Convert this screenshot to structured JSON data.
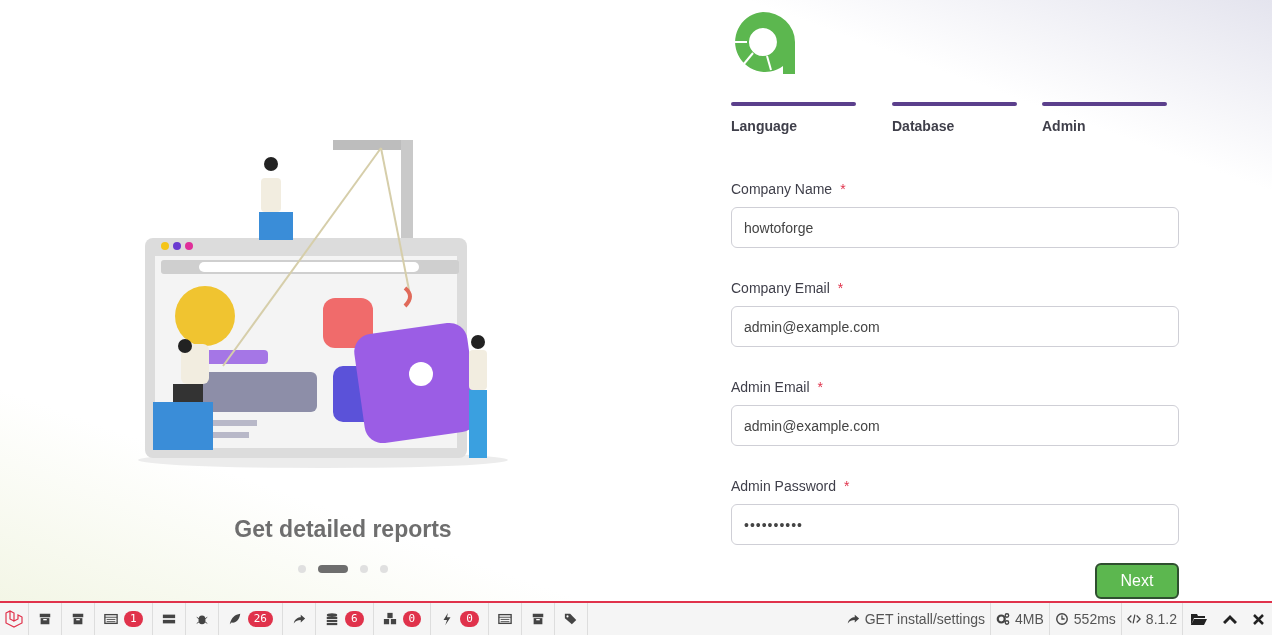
{
  "slideshow": {
    "caption": "Get detailed reports",
    "dots": [
      {
        "selected": false
      },
      {
        "selected": true
      },
      {
        "selected": false
      },
      {
        "selected": false
      }
    ]
  },
  "steps": [
    {
      "label": "Language",
      "completed": true
    },
    {
      "label": "Database",
      "completed": true
    },
    {
      "label": "Admin",
      "completed": true
    }
  ],
  "form": {
    "fields": [
      {
        "label": "Company Name",
        "required_mark": "*",
        "kind": "text",
        "value": "howtoforge"
      },
      {
        "label": "Company Email",
        "required_mark": "*",
        "kind": "text",
        "value": "admin@example.com"
      },
      {
        "label": "Admin Email",
        "required_mark": "*",
        "kind": "text",
        "value": "admin@example.com"
      },
      {
        "label": "Admin Password",
        "required_mark": "*",
        "kind": "password",
        "value": "••••••••••"
      }
    ],
    "next_button": "Next"
  },
  "debugbar": {
    "items": [
      {
        "kind": "archive"
      },
      {
        "kind": "archive"
      },
      {
        "kind": "table",
        "badge": "1"
      },
      {
        "kind": "rows"
      },
      {
        "kind": "bug"
      },
      {
        "kind": "leaf",
        "badge": "26"
      },
      {
        "kind": "share"
      },
      {
        "kind": "database",
        "badge": "6"
      },
      {
        "kind": "cubes",
        "badge": "0"
      },
      {
        "kind": "bolt",
        "badge": "0"
      },
      {
        "kind": "table"
      },
      {
        "kind": "archive"
      },
      {
        "kind": "tags"
      }
    ],
    "status": [
      {
        "kind": "share",
        "text": "GET install/settings"
      },
      {
        "kind": "gears",
        "text": "4MB"
      },
      {
        "kind": "clock",
        "text": "552ms"
      },
      {
        "kind": "code",
        "text": "8.1.2"
      }
    ]
  }
}
